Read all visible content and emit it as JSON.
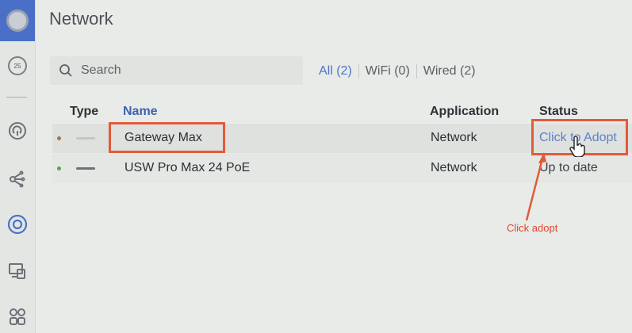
{
  "header": {
    "title": "Network"
  },
  "sidebar": {
    "items": [
      {
        "icon": "circle-logo-icon"
      },
      {
        "icon": "badge-25-icon",
        "label": "25"
      },
      {
        "icon": "circular-arrow-icon"
      },
      {
        "icon": "topology-icon"
      },
      {
        "icon": "target-circle-icon"
      },
      {
        "icon": "devices-icon"
      },
      {
        "icon": "grid-apps-icon"
      }
    ]
  },
  "search": {
    "placeholder": "Search",
    "value": ""
  },
  "filters": [
    {
      "label": "All (2)",
      "active": true
    },
    {
      "label": "WiFi (0)",
      "active": false
    },
    {
      "label": "Wired (2)",
      "active": false
    }
  ],
  "table": {
    "columns": {
      "type": "Type",
      "name": "Name",
      "application": "Application",
      "status": "Status"
    },
    "rows": [
      {
        "name": "Gateway Max",
        "application": "Network",
        "status": "Click to Adopt",
        "status_is_link": true,
        "dot_color": "#a0764a",
        "icon_color": "#c4c6c4"
      },
      {
        "name": "USW Pro Max 24 PoE",
        "application": "Network",
        "status": "Up to date",
        "status_is_link": false,
        "dot_color": "#5fa05a",
        "icon_color": "#6e7277"
      }
    ]
  },
  "annotation": {
    "text": "Click adopt",
    "color": "#e25a3a"
  },
  "colors": {
    "accent": "#4a74c9",
    "sidebar_logo": "#4a6fc7"
  }
}
